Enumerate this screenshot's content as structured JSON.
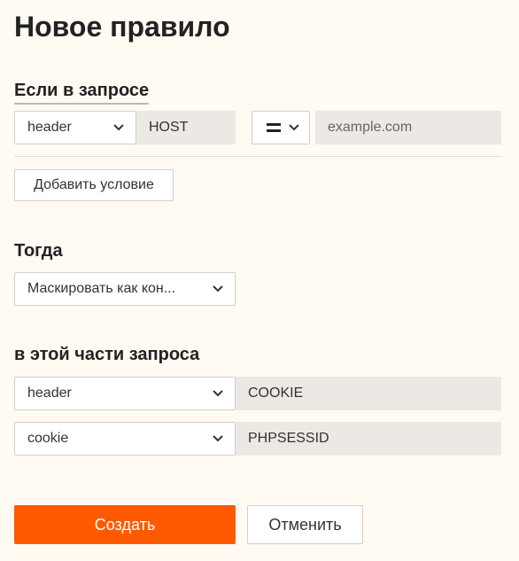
{
  "page": {
    "title": "Новое правило"
  },
  "condition": {
    "heading": "Если в запросе",
    "part_select": {
      "value": "header",
      "icon": "chevron-down-icon"
    },
    "name_value": "HOST",
    "operator": {
      "icon": "equals-icon"
    },
    "value_placeholder": "example.com",
    "add_button_label": "Добавить условие"
  },
  "action": {
    "heading": "Тогда",
    "select": {
      "value": "Маскировать как кон...",
      "icon": "chevron-down-icon"
    }
  },
  "target": {
    "heading": "в этой части запроса",
    "rows": [
      {
        "select_value": "header",
        "field_value": "COOKIE"
      },
      {
        "select_value": "cookie",
        "field_value": "PHPSESSID"
      }
    ]
  },
  "footer": {
    "create_label": "Создать",
    "cancel_label": "Отменить"
  },
  "colors": {
    "background": "#fffaf2",
    "accent": "#ff5a00",
    "field_bg": "#ece9e4"
  }
}
